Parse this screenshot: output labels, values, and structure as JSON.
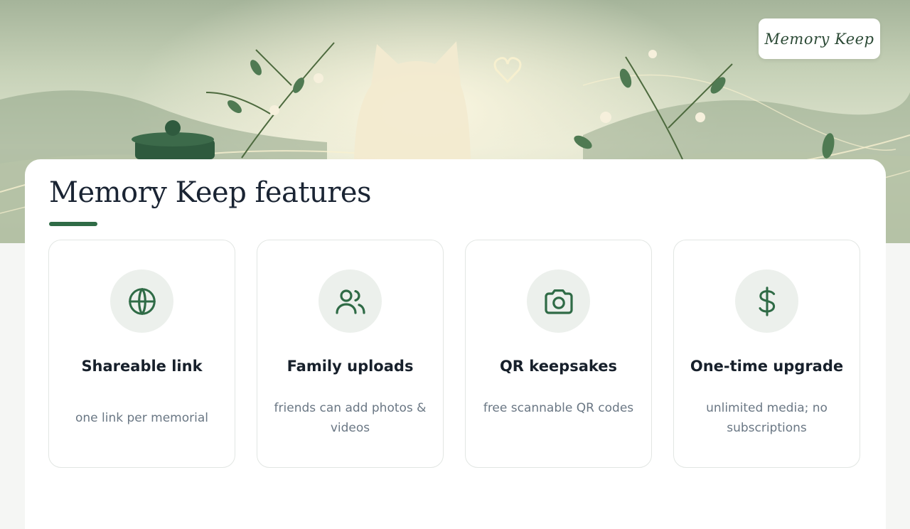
{
  "brand": {
    "name": "Memory Keep"
  },
  "features_section": {
    "title": "Memory Keep features",
    "accent_color": "#2f6b46",
    "icon_bg_color": "#ecf0ec",
    "cards": [
      {
        "icon": "globe-icon",
        "title": "Shareable link",
        "description": "one link per memorial"
      },
      {
        "icon": "users-icon",
        "title": "Family uploads",
        "description": "friends can add photos & videos"
      },
      {
        "icon": "camera-icon",
        "title": "QR keepsakes",
        "description": "free scannable QR codes"
      },
      {
        "icon": "dollar-icon",
        "title": "One-time upgrade",
        "description": "unlimited media; no subscriptions"
      }
    ]
  }
}
